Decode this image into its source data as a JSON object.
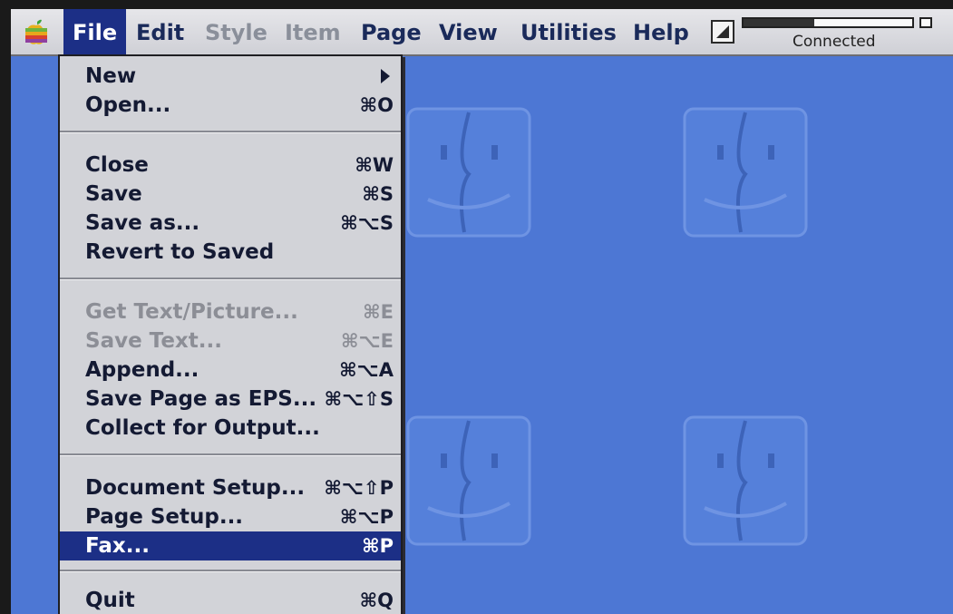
{
  "menubar": {
    "apple_icon": "apple-menu-icon",
    "menus": [
      {
        "label": "File",
        "state": "active"
      },
      {
        "label": "Edit",
        "state": "enabled"
      },
      {
        "label": "Style",
        "state": "disabled"
      },
      {
        "label": "Item",
        "state": "disabled"
      },
      {
        "label": "Page",
        "state": "enabled"
      },
      {
        "label": "View",
        "state": "enabled"
      },
      {
        "label": "Utilities",
        "state": "enabled"
      },
      {
        "label": "Help",
        "state": "enabled"
      }
    ],
    "status_icon": "application-strip-icon",
    "connection": {
      "text": "Connected",
      "progress": 0.42
    }
  },
  "file_menu": {
    "items": [
      {
        "label": "New",
        "shortcut": "",
        "submenu": true,
        "disabled": false
      },
      {
        "label": "Open...",
        "shortcut": "⌘O",
        "disabled": false
      },
      {
        "label": "Close",
        "shortcut": "⌘W",
        "disabled": false
      },
      {
        "label": "Save",
        "shortcut": "⌘S",
        "disabled": false
      },
      {
        "label": "Save as...",
        "shortcut": "⌘⌥S",
        "disabled": false
      },
      {
        "label": "Revert to Saved",
        "shortcut": "",
        "disabled": false
      },
      {
        "label": "Get Text/Picture...",
        "shortcut": "⌘E",
        "disabled": true
      },
      {
        "label": "Save Text...",
        "shortcut": "⌘⌥E",
        "disabled": true
      },
      {
        "label": "Append...",
        "shortcut": "⌘⌥A",
        "disabled": false
      },
      {
        "label": "Save Page as EPS...",
        "shortcut": "⌘⌥⇧S",
        "disabled": false
      },
      {
        "label": "Collect for Output...",
        "shortcut": "",
        "disabled": false
      },
      {
        "label": "Document Setup...",
        "shortcut": "⌘⌥⇧P",
        "disabled": false
      },
      {
        "label": "Page Setup...",
        "shortcut": "⌘⌥P",
        "disabled": false
      },
      {
        "label": "Fax...",
        "shortcut": "⌘P",
        "disabled": false,
        "highlighted": true
      },
      {
        "label": "Quit",
        "shortcut": "⌘Q",
        "disabled": false
      }
    ]
  },
  "colors": {
    "desktop": "#4d77d4",
    "menu_highlight": "#1c2f86",
    "menu_background": "#d2d3d8"
  }
}
